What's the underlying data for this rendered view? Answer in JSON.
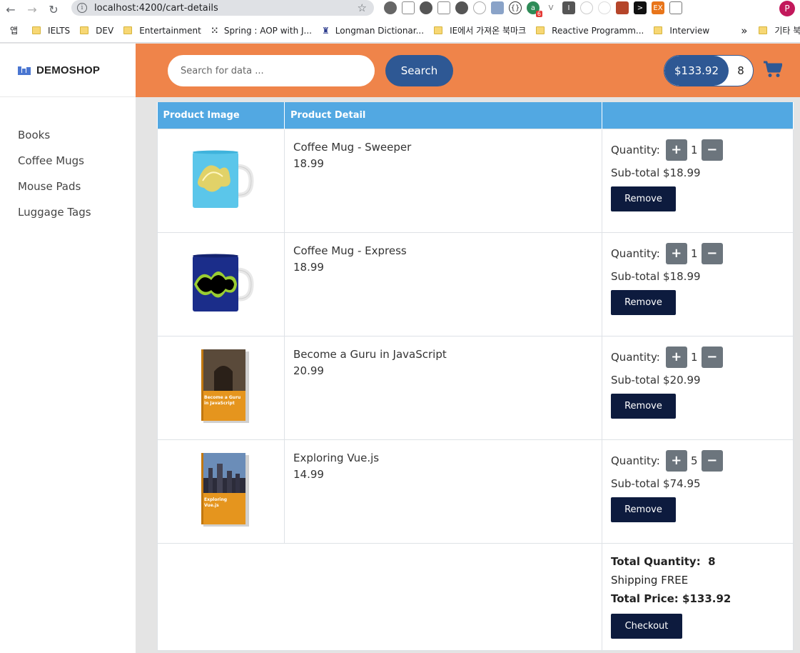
{
  "browser": {
    "url": "localhost:4200/cart-details",
    "bookmarks": [
      {
        "label": "앱",
        "icon": "apps-icon"
      },
      {
        "label": "IELTS",
        "icon": "folder-icon"
      },
      {
        "label": "DEV",
        "icon": "folder-icon"
      },
      {
        "label": "Entertainment",
        "icon": "folder-icon"
      },
      {
        "label": "Spring : AOP with J...",
        "icon": "dots-icon"
      },
      {
        "label": "Longman Dictionar...",
        "icon": "longman-icon"
      },
      {
        "label": "IE에서 가져온 북마크",
        "icon": "folder-icon"
      },
      {
        "label": "Reactive Programm...",
        "icon": "folder-icon"
      },
      {
        "label": "Interview",
        "icon": "folder-icon"
      }
    ],
    "overflow_label": "»",
    "other_bookmarks": "기타 북마크",
    "profile_initial": "P",
    "extension_badge": "6"
  },
  "brand": {
    "name": "DEMOSHOP"
  },
  "categories": [
    "Books",
    "Coffee Mugs",
    "Mouse Pads",
    "Luggage Tags"
  ],
  "search": {
    "placeholder": "Search for data ...",
    "button": "Search"
  },
  "cart_status": {
    "total": "$133.92",
    "quantity": "8"
  },
  "table": {
    "col_image": "Product Image",
    "col_detail": "Product Detail",
    "col_actions": ""
  },
  "labels": {
    "quantity": "Quantity:",
    "subtotal": "Sub-total",
    "remove": "Remove",
    "plus": "+",
    "minus": "−"
  },
  "items": [
    {
      "name": "Coffee Mug - Sweeper",
      "price": "18.99",
      "quantity": "1",
      "subtotal": "$18.99",
      "image": "mug-sweeper"
    },
    {
      "name": "Coffee Mug - Express",
      "price": "18.99",
      "quantity": "1",
      "subtotal": "$18.99",
      "image": "mug-express"
    },
    {
      "name": "Become a Guru in JavaScript",
      "price": "20.99",
      "quantity": "1",
      "subtotal": "$20.99",
      "image": "book-guru-js",
      "cover_title": "Become a Guru in JavaScript"
    },
    {
      "name": "Exploring Vue.js",
      "price": "14.99",
      "quantity": "5",
      "subtotal": "$74.95",
      "image": "book-vuejs",
      "cover_title": "Exploring Vue.js"
    }
  ],
  "summary": {
    "total_quantity_label": "Total Quantity:",
    "total_quantity": "8",
    "shipping": "Shipping FREE",
    "total_price_label": "Total Price:",
    "total_price": "$133.92",
    "checkout": "Checkout"
  },
  "colors": {
    "header": "#ef844a",
    "primary": "#2e5894",
    "table_header": "#52a8e2",
    "dark_button": "#0d1b3e"
  }
}
